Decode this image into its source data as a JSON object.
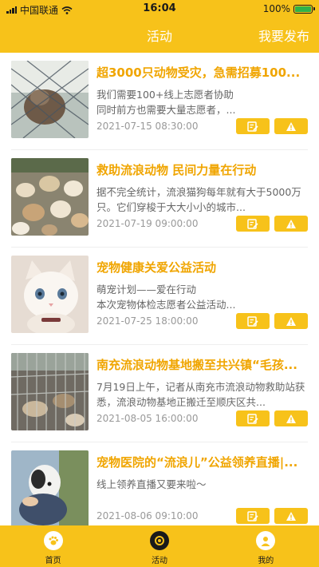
{
  "status_bar": {
    "carrier": "中国联通",
    "time": "16:04",
    "battery": "100%"
  },
  "nav": {
    "title": "活动",
    "action": "我要发布"
  },
  "activities": [
    {
      "title": "超3000只动物受灾，急需招募100...",
      "desc": "我们需要100+线上志愿者协助\n同时前方也需要大量志愿者，...",
      "date": "2021-07-15 08:30:00",
      "image": "cat-behind-fence"
    },
    {
      "title": "救助流浪动物 民间力量在行动",
      "desc": "据不完全统计，流浪猫狗每年就有大于5000万只。它们穿梭于大大小小的城市...",
      "date": "2021-07-19 09:00:00",
      "image": "group-of-dogs"
    },
    {
      "title": "宠物健康关爱公益活动",
      "desc": "萌宠计划——爱在行动\n本次宠物体检志愿者公益活动...",
      "date": "2021-07-25 18:00:00",
      "image": "white-kitten"
    },
    {
      "title": "南充流浪动物基地搬至共兴镇“毛孩...",
      "desc": "7月19日上午，记者从南充市流浪动物救助站获悉，流浪动物基地正搬迁至顺庆区共...",
      "date": "2021-08-05 16:00:00",
      "image": "dogs-in-cages"
    },
    {
      "title": "宠物医院的“流浪儿”公益领养直播|...",
      "desc": "线上领养直播又要来啦～",
      "date": "2021-08-06 09:10:00",
      "image": "dog-held-in-arms"
    }
  ],
  "tabbar": [
    {
      "label": "首页",
      "icon": "home-paw-icon"
    },
    {
      "label": "活动",
      "icon": "activity-ring-icon",
      "active": true
    },
    {
      "label": "我的",
      "icon": "profile-icon"
    }
  ],
  "colors": {
    "brand_yellow": "#f7c21a",
    "title_orange": "#f0a500"
  }
}
